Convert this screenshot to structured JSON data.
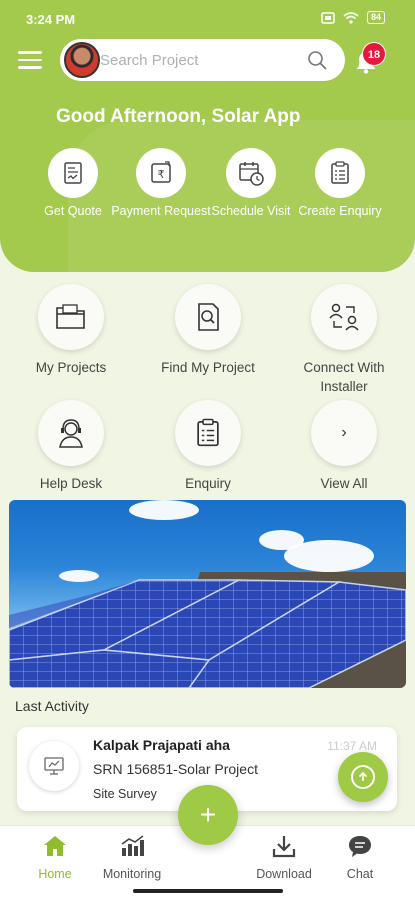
{
  "status_bar": {
    "time": "3:24 PM",
    "battery": "84"
  },
  "search": {
    "placeholder": "Search Project"
  },
  "notifications": {
    "count": "18"
  },
  "greeting": "Good Afternoon, Solar App",
  "quick_actions": [
    {
      "label": "Get Quote",
      "icon": "quote-icon"
    },
    {
      "label": "Payment Request",
      "icon": "rupee-payment-icon"
    },
    {
      "label": "Schedule Visit",
      "icon": "calendar-clock-icon"
    },
    {
      "label": "Create Enquiry",
      "icon": "clipboard-list-icon"
    }
  ],
  "menu_grid": [
    {
      "label": "My Projects",
      "icon": "folder-icon"
    },
    {
      "label": "Find My Project",
      "icon": "document-search-icon"
    },
    {
      "label": "Connect With Installer",
      "icon": "people-connect-icon"
    },
    {
      "label": "Help Desk",
      "icon": "support-agent-icon"
    },
    {
      "label": "Enquiry",
      "icon": "clipboard-list-icon"
    },
    {
      "label": "View All",
      "icon": "chevron-right-icon"
    }
  ],
  "last_activity": {
    "title": "Last Activity",
    "name": "Kalpak Prajapati aha",
    "srn": "SRN 156851-Solar Project",
    "stage": "Site Survey",
    "time": "11:37 AM"
  },
  "bottom_nav": [
    {
      "label": "Home",
      "icon": "home-icon",
      "active": true
    },
    {
      "label": "Monitoring",
      "icon": "chart-icon",
      "active": false
    },
    {
      "label": "Download",
      "icon": "download-icon",
      "active": false
    },
    {
      "label": "Chat",
      "icon": "chat-icon",
      "active": false
    }
  ],
  "fab": {
    "label": "+"
  },
  "colors": {
    "primary": "#a3c94d",
    "background": "#f1f6e4",
    "badge": "#e21b3c"
  }
}
